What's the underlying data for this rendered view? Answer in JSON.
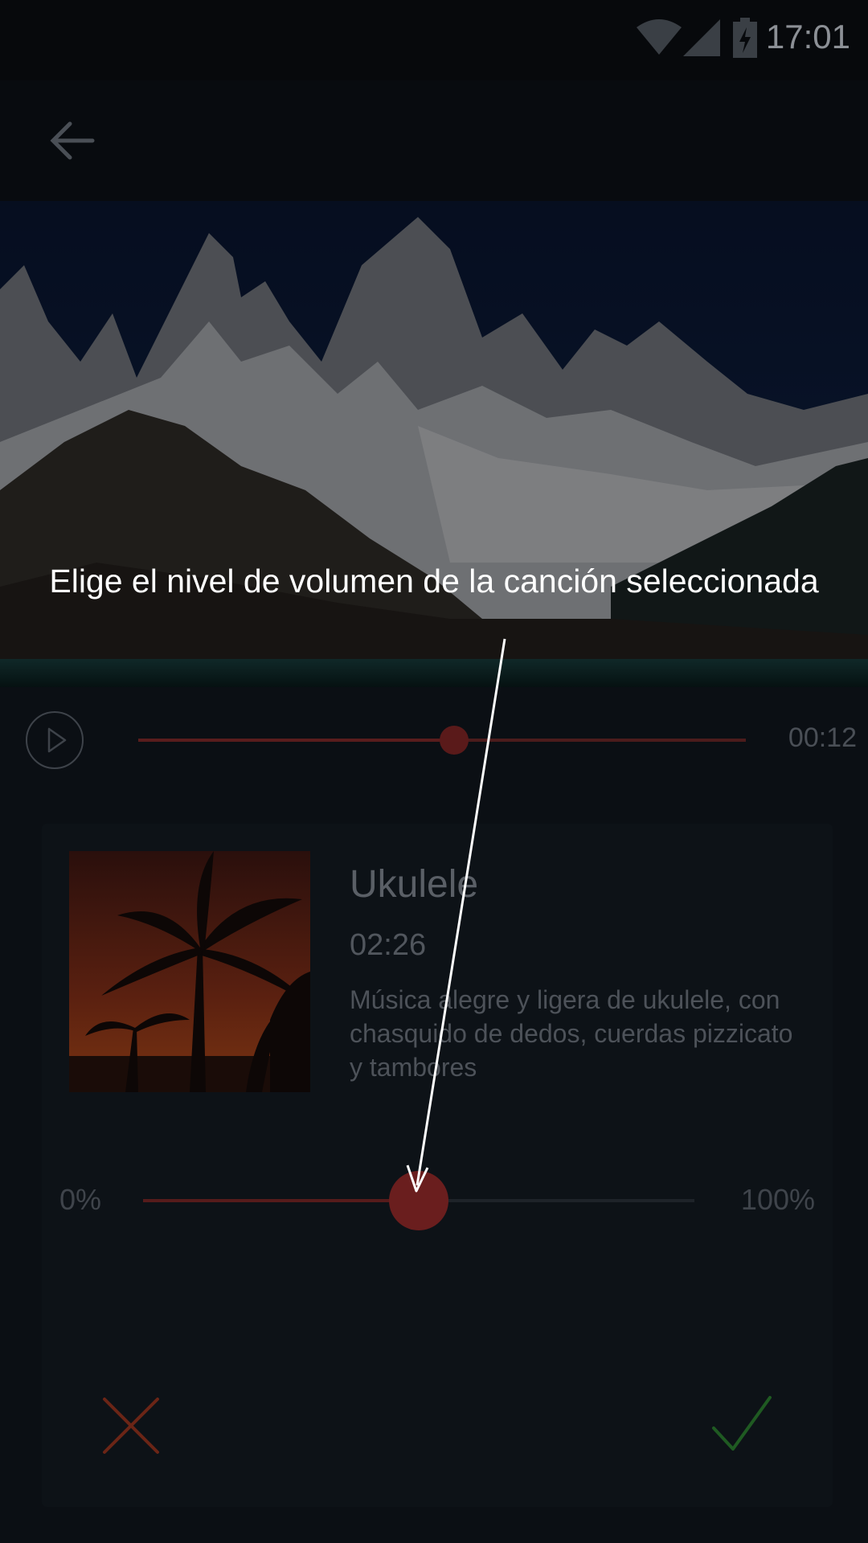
{
  "status_bar": {
    "time": "17:01",
    "icons": [
      "wifi-icon",
      "signal-icon",
      "battery-charging-icon"
    ]
  },
  "toolbar": {
    "back_icon": "arrow-back-icon"
  },
  "tutorial": {
    "text": "Elige el nivel de volumen de la canción seleccionada"
  },
  "player": {
    "play_icon": "play-icon",
    "elapsed": "00:12",
    "progress": 0.52
  },
  "song": {
    "title": "Ukulele",
    "duration": "02:26",
    "description": "Música alegre y ligera de ukulele, con chasquido de dedos, cuerdas pizzicato y tambores"
  },
  "volume": {
    "min_label": "0%",
    "max_label": "100%",
    "value": 0.5
  },
  "actions": {
    "cancel_icon": "close-icon",
    "confirm_icon": "check-icon"
  },
  "colors": {
    "accent": "#6a1e1e",
    "cancel": "#7a2a1e",
    "confirm": "#1f5a22"
  }
}
